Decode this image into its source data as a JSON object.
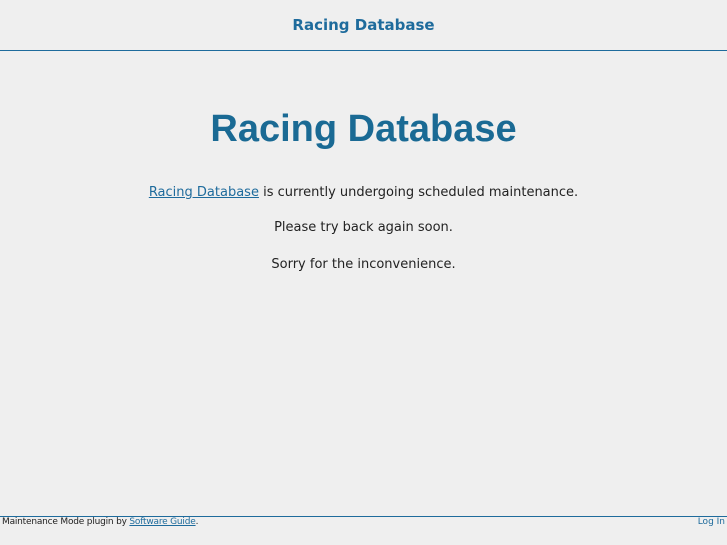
{
  "header": {
    "title": "Racing Database"
  },
  "main": {
    "title": "Racing Database",
    "message_link": "Racing Database",
    "message_rest": " is currently undergoing scheduled maintenance.",
    "line2": "Please try back again soon.",
    "line3": "Sorry for the inconvenience."
  },
  "footer": {
    "credit_prefix": "Maintenance Mode plugin by ",
    "credit_link": "Software Guide",
    "credit_suffix": ".",
    "login_label": "Log In"
  },
  "colors": {
    "accent": "#1e6b9c",
    "background": "#efefef"
  }
}
